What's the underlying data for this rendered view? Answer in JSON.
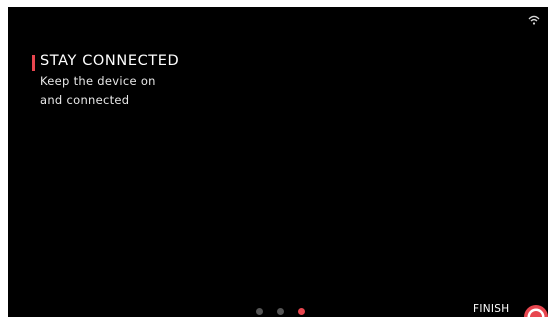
{
  "onboarding": {
    "title": "STAY CONNECTED",
    "subtitle_lines": [
      "Keep the device on",
      "and connected"
    ],
    "accent_color": "#e8464f"
  },
  "status_bar": {
    "icon": "wifi-icon"
  },
  "pagination": {
    "total": 3,
    "active_index": 2,
    "active_color": "#e8464f",
    "inactive_color": "#555555"
  },
  "footer": {
    "finish_label": "FINISH",
    "finish_icon": "finish-target-icon"
  }
}
